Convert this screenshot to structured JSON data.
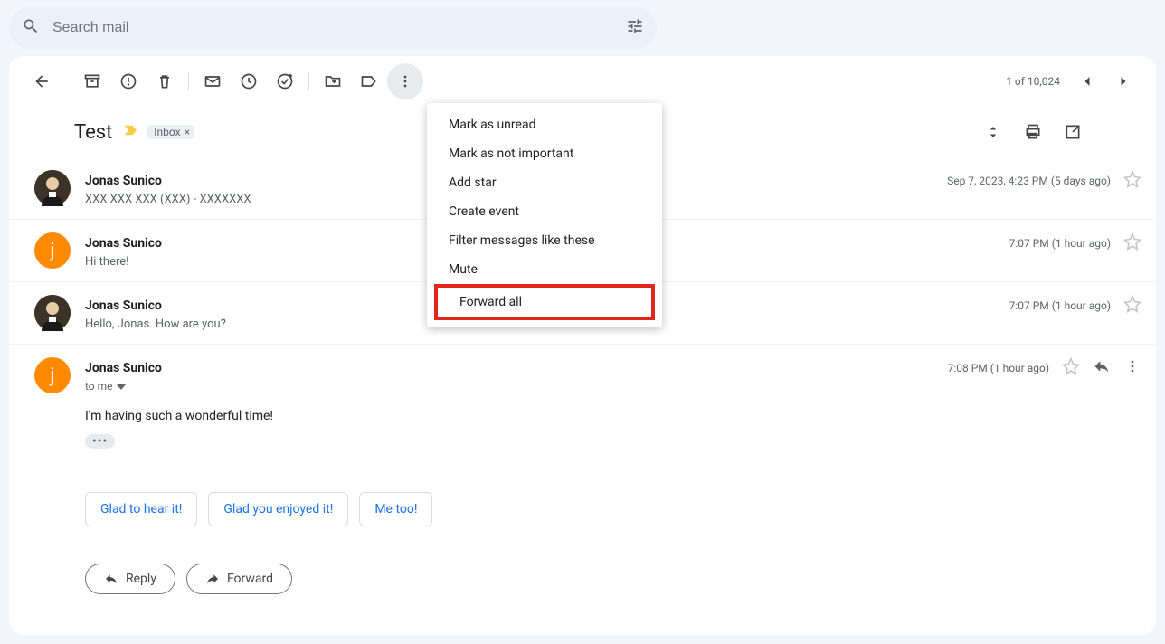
{
  "search": {
    "placeholder": "Search mail"
  },
  "pagination": {
    "text": "1 of 10,024"
  },
  "subject": "Test",
  "label": "Inbox",
  "menu": {
    "items": [
      "Mark as unread",
      "Mark as not important",
      "Add star",
      "Create event",
      "Filter messages like these",
      "Mute",
      "Forward all"
    ],
    "highlight_index": 6
  },
  "messages": [
    {
      "sender": "Jonas Sunico",
      "snippet": "XXX XXX XXX (XXX) - XXXXXXX",
      "time": "Sep 7, 2023, 4:23 PM (5 days ago)",
      "avatar": "photo"
    },
    {
      "sender": "Jonas Sunico",
      "snippet": "Hi there!",
      "time": "7:07 PM (1 hour ago)",
      "avatar": "letter"
    },
    {
      "sender": "Jonas Sunico",
      "snippet": "Hello, Jonas. How are you?",
      "time": "7:07 PM (1 hour ago)",
      "avatar": "photo"
    }
  ],
  "expanded": {
    "sender": "Jonas Sunico",
    "to": "to me",
    "time": "7:08 PM (1 hour ago)",
    "body": "I'm having such a wonderful time!",
    "avatar": "letter"
  },
  "suggestions": [
    "Glad to hear it!",
    "Glad you enjoyed it!",
    "Me too!"
  ],
  "actions": {
    "reply": "Reply",
    "forward": "Forward"
  }
}
